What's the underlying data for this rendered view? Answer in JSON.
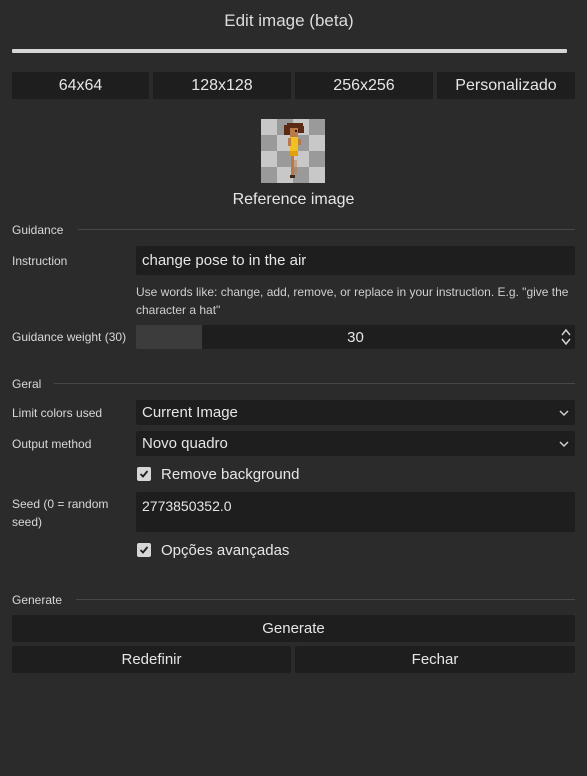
{
  "dialog": {
    "title": "Edit image (beta)"
  },
  "sizes": [
    "64x64",
    "128x128",
    "256x256",
    "Personalizado"
  ],
  "reference": {
    "label": "Reference image"
  },
  "guidance": {
    "section_label": "Guidance",
    "instruction_label": "Instruction",
    "instruction_value": "change pose to in the air",
    "hint_line1": "Use words like: change, add, remove, or replace in your instruction. E.g. \"give the",
    "hint_line2": "character a hat\"",
    "weight_label": "Guidance weight (30)",
    "weight_value": "30",
    "weight_fraction": 0.15
  },
  "geral": {
    "section_label": "Geral",
    "limit_colors_label": "Limit colors used",
    "limit_colors_value": "Current Image",
    "output_method_label": "Output method",
    "output_method_value": "Novo quadro",
    "remove_bg_label": "Remove background",
    "remove_bg_checked": true,
    "seed_label_line1": "Seed (0 = random",
    "seed_label_line2": "seed)",
    "seed_value": "2773850352.0",
    "advanced_label": "Opções avançadas",
    "advanced_checked": true
  },
  "generate": {
    "section_label": "Generate",
    "generate_button": "Generate",
    "reset_button": "Redefinir",
    "close_button": "Fechar"
  }
}
